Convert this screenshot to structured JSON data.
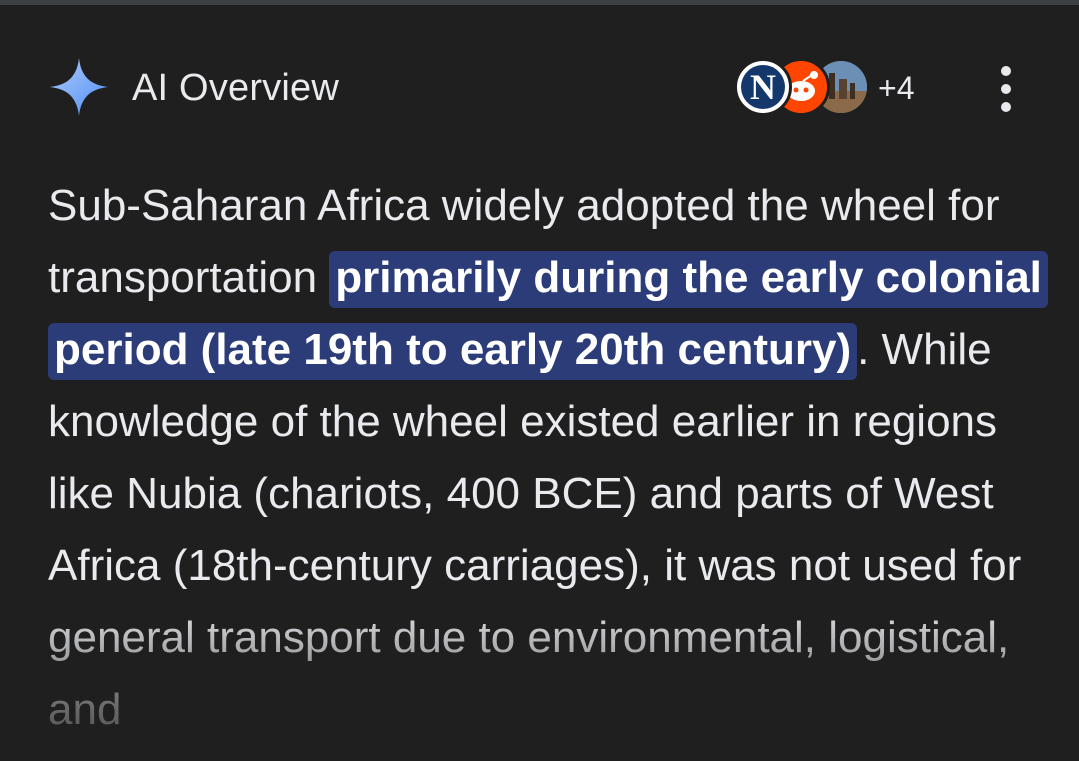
{
  "header": {
    "title": "AI Overview",
    "more_sources_count": "+4",
    "icons": {
      "sparkle": "ai-sparkle-icon",
      "menu": "more-vert-icon"
    },
    "source_avatars": [
      {
        "name": "source-avatar-news",
        "glyph": "N"
      },
      {
        "name": "source-avatar-reddit"
      },
      {
        "name": "source-avatar-photo"
      }
    ]
  },
  "overview": {
    "text_before": "Sub-Saharan Africa widely adopted the wheel for transportation ",
    "highlight": "primarily during the early colonial period (late 19th to early 20th century)",
    "text_after": ". While knowledge of the wheel existed earlier in regions like Nubia (chariots, 400 BCE) and parts of West Africa (18th-century carriages), it was not used for general transport due to environmental, logistical, and"
  },
  "colors": {
    "background": "#1f1f1f",
    "text": "#e8eaed",
    "highlight_bg": "#2c3c78",
    "sparkle_blue": "#8ab4f8"
  }
}
